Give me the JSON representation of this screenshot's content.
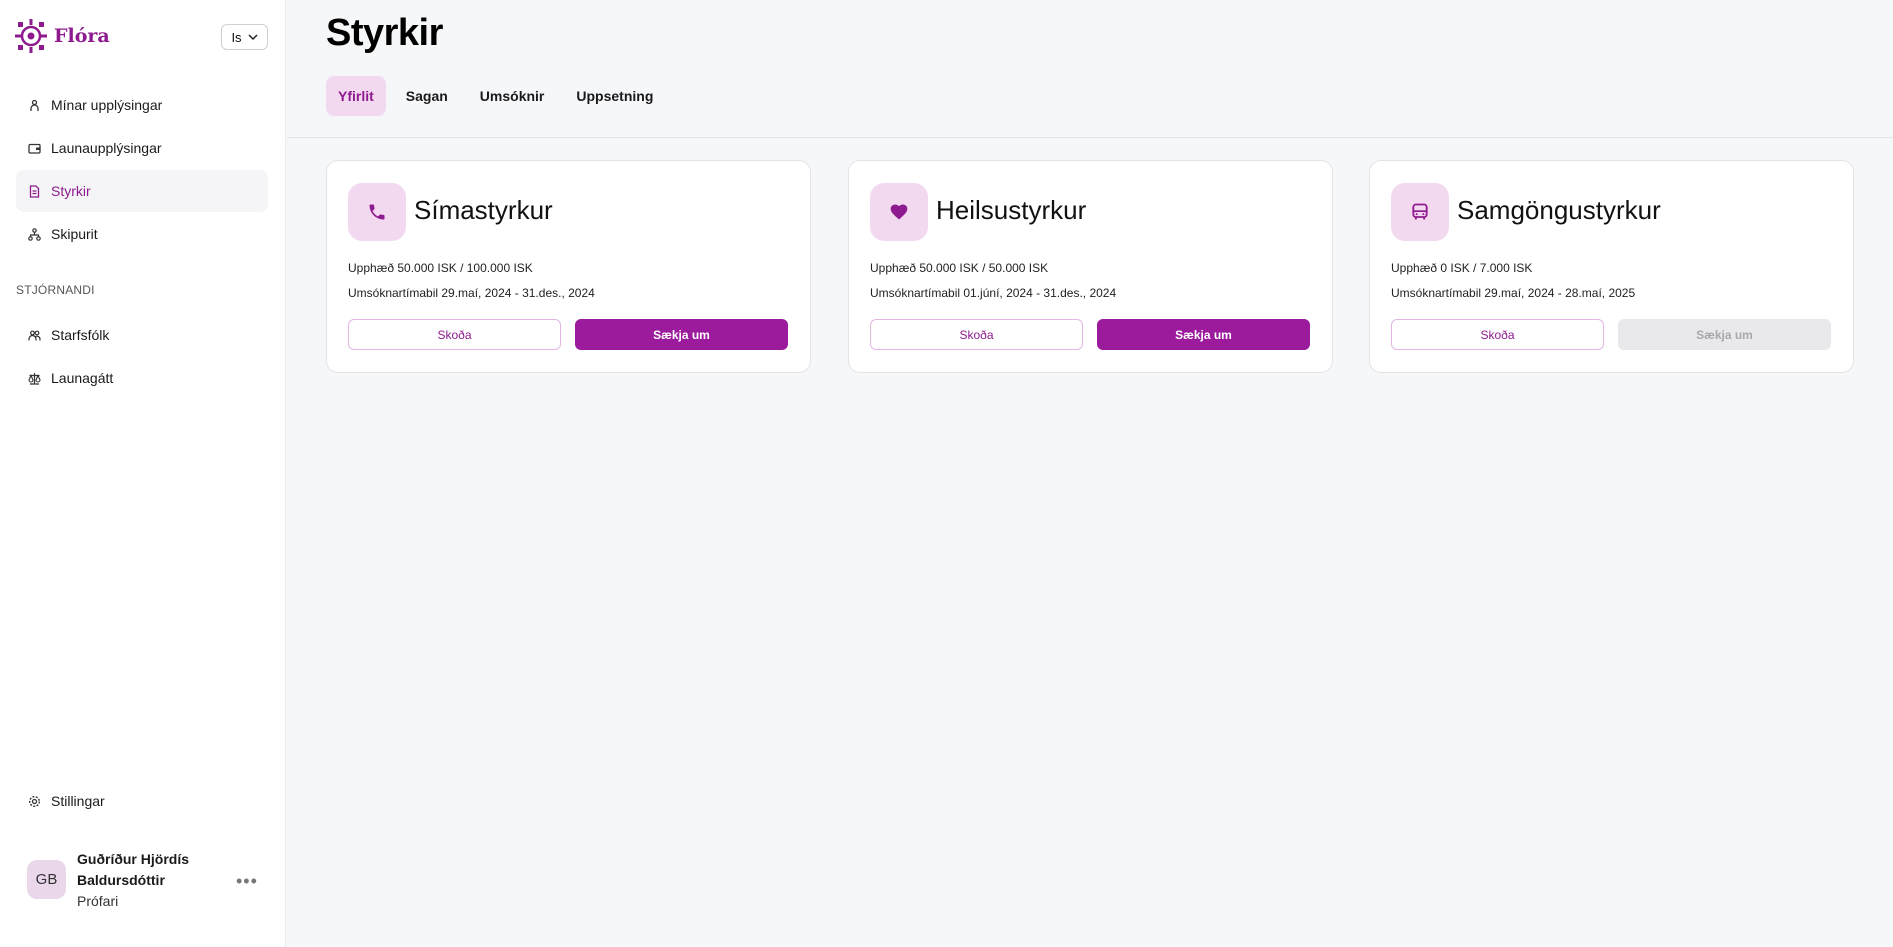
{
  "brand": {
    "name": "Flóra",
    "accent": "#8d1a8e"
  },
  "language": {
    "selected": "Is"
  },
  "sidebar": {
    "items": [
      {
        "label": "Mínar upplýsingar",
        "icon": "person-icon"
      },
      {
        "label": "Launaupplýsingar",
        "icon": "wallet-icon"
      },
      {
        "label": "Styrkir",
        "icon": "document-icon",
        "active": true
      },
      {
        "label": "Skipurit",
        "icon": "org-chart-icon"
      }
    ],
    "section_label": "STJÓRNANDI",
    "manager_items": [
      {
        "label": "Starfsfólk",
        "icon": "users-icon"
      },
      {
        "label": "Launagátt",
        "icon": "scale-icon"
      }
    ],
    "settings_label": "Stillingar"
  },
  "user": {
    "initials": "GB",
    "name": "Guðríður Hjördís Baldursdóttir",
    "role": "Prófari",
    "more": "•••"
  },
  "page": {
    "title": "Styrkir",
    "tabs": [
      "Yfirlit",
      "Sagan",
      "Umsóknir",
      "Uppsetning"
    ],
    "active_tab": "Yfirlit"
  },
  "cards": [
    {
      "title": "Símastyrkur",
      "icon": "phone-icon",
      "amount_label": "Upphæð",
      "amount": "50.000 ISK / 100.000 ISK",
      "period_label": "Umsóknartímabil",
      "period": "29.maí, 2024 - 31.des., 2024",
      "view_label": "Skoða",
      "apply_label": "Sækja um",
      "apply_enabled": true
    },
    {
      "title": "Heilsustyrkur",
      "icon": "heart-icon",
      "amount_label": "Upphæð",
      "amount": "50.000 ISK / 50.000 ISK",
      "period_label": "Umsóknartímabil",
      "period": "01.júní, 2024 - 31.des., 2024",
      "view_label": "Skoða",
      "apply_label": "Sækja um",
      "apply_enabled": true
    },
    {
      "title": "Samgöngustyrkur",
      "icon": "bus-icon",
      "amount_label": "Upphæð",
      "amount": "0 ISK / 7.000 ISK",
      "period_label": "Umsóknartímabil",
      "period": "29.maí, 2024 - 28.maí, 2025",
      "view_label": "Skoða",
      "apply_label": "Sækja um",
      "apply_enabled": false
    }
  ]
}
